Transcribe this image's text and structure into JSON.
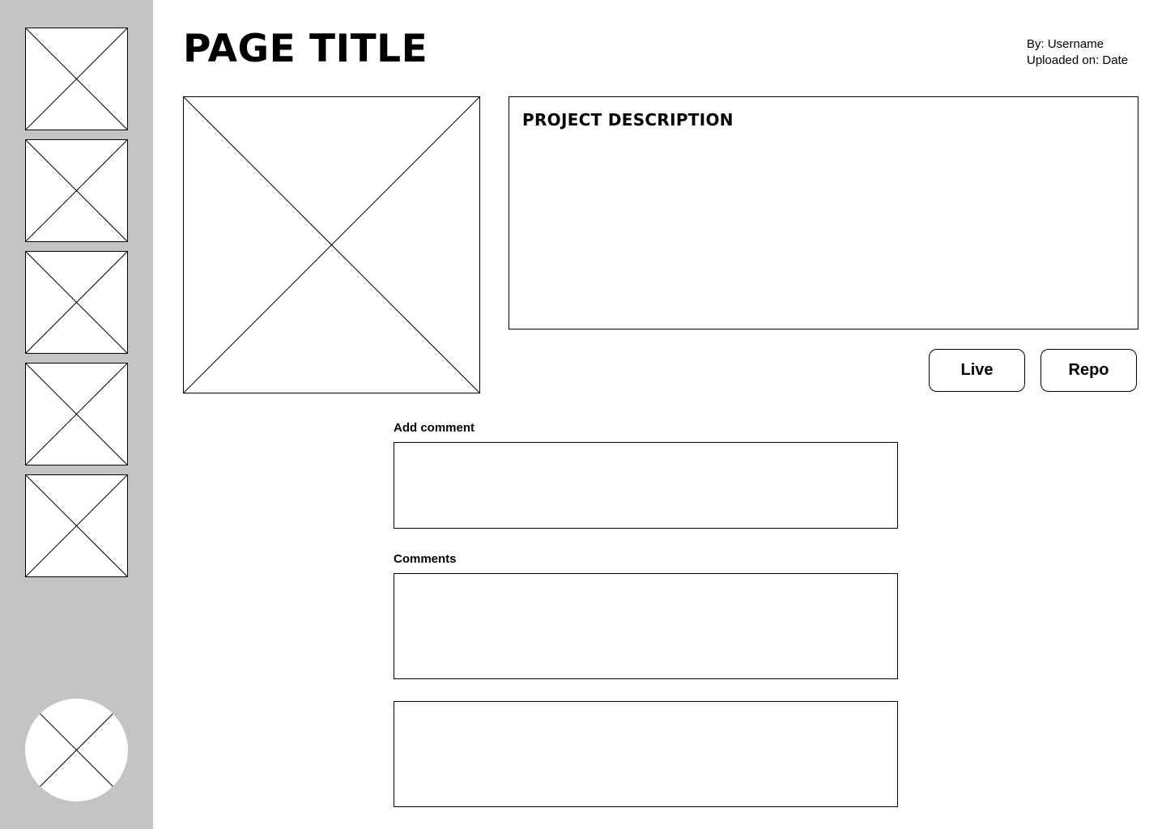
{
  "page": {
    "title": "PAGE TITLE",
    "author": "By: Username",
    "uploaded": "Uploaded on: Date"
  },
  "sidebar": {
    "thumbnails": [
      {
        "icon": "image-placeholder-icon"
      },
      {
        "icon": "image-placeholder-icon"
      },
      {
        "icon": "image-placeholder-icon"
      },
      {
        "icon": "image-placeholder-icon"
      },
      {
        "icon": "image-placeholder-icon"
      }
    ],
    "avatar_icon": "avatar-placeholder-icon",
    "background_color": "#c4c4c4"
  },
  "project": {
    "image_icon": "image-placeholder-icon",
    "description_title": "PROJECT DESCRIPTION",
    "description_body": ""
  },
  "actions": {
    "live_label": "Live",
    "repo_label": "Repo"
  },
  "comments": {
    "add_label": "Add comment",
    "input_value": "",
    "list_label": "Comments",
    "items": [
      {
        "text": ""
      },
      {
        "text": ""
      }
    ]
  }
}
